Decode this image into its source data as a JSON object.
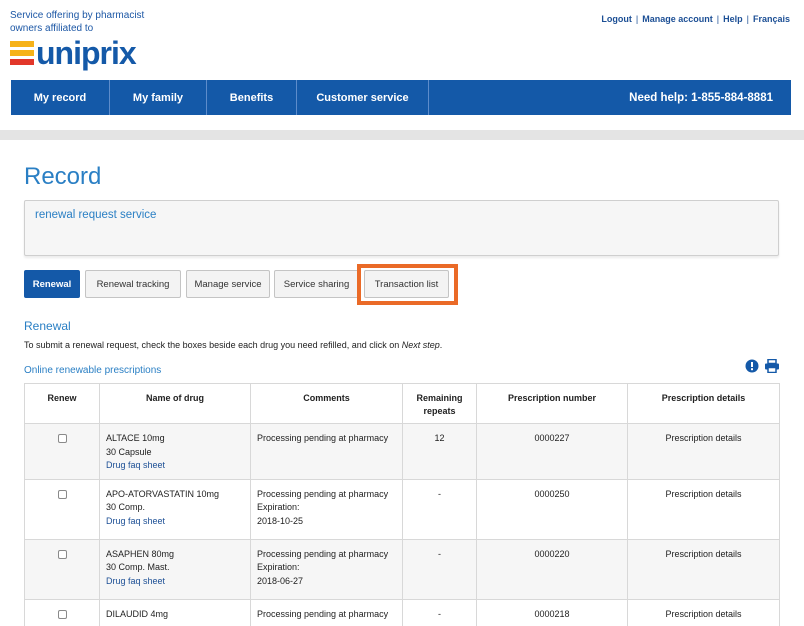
{
  "brand": {
    "tagline": "Service offering by pharmacist owners affiliated to",
    "logo_text": "uniprix"
  },
  "top_links": [
    "Logout",
    "Manage account",
    "Help",
    "Français"
  ],
  "nav": {
    "items": [
      "My record",
      "My family",
      "Benefits",
      "Customer service"
    ],
    "help": "Need help: 1-855-884-8881"
  },
  "page": {
    "title": "Record",
    "service_name": "renewal request service"
  },
  "tabs": [
    "Renewal",
    "Renewal tracking",
    "Manage service",
    "Service sharing",
    "Transaction list"
  ],
  "active_tab": "Renewal",
  "highlighted_tab": "Transaction list",
  "renewal": {
    "title": "Renewal",
    "instructions_prefix": "To submit a renewal request, check the boxes beside each drug you need refilled, and click on ",
    "instructions_emph": "Next step",
    "instructions_suffix": ".",
    "online_label": "Online renewable prescriptions"
  },
  "table": {
    "headers": [
      "Renew",
      "Name of drug",
      "Comments",
      "Remaining repeats",
      "Prescription number",
      "Prescription details"
    ],
    "rows": [
      {
        "drug": "ALTACE 10mg",
        "form": "30 Capsule",
        "faq": "Drug faq sheet",
        "comment": "Processing pending at pharmacy",
        "expiration_label": "",
        "expiration": "",
        "repeats": "12",
        "number": "0000227",
        "details": "Prescription details"
      },
      {
        "drug": "APO-ATORVASTATIN 10mg",
        "form": "30 Comp.",
        "faq": "Drug faq sheet",
        "comment": "Processing pending at pharmacy",
        "expiration_label": "Expiration:",
        "expiration": "2018-10-25",
        "repeats": "-",
        "number": "0000250",
        "details": "Prescription details"
      },
      {
        "drug": "ASAPHEN 80mg",
        "form": "30 Comp. Mast.",
        "faq": "Drug faq sheet",
        "comment": "Processing pending at pharmacy",
        "expiration_label": "Expiration:",
        "expiration": "2018-06-27",
        "repeats": "-",
        "number": "0000220",
        "details": "Prescription details"
      },
      {
        "drug": "DILAUDID 4mg",
        "form": "",
        "faq": "",
        "comment": "Processing pending at pharmacy",
        "expiration_label": "",
        "expiration": "",
        "repeats": "-",
        "number": "0000218",
        "details": "Prescription details"
      }
    ]
  },
  "colors": {
    "primary_blue": "#1459a8",
    "accent_blue": "#2a7fc4",
    "highlight_orange": "#ea6a27",
    "logo_yellow": "#f6b219",
    "logo_red": "#e2372a"
  },
  "icons": [
    "info-icon",
    "print-icon",
    "checkbox"
  ]
}
